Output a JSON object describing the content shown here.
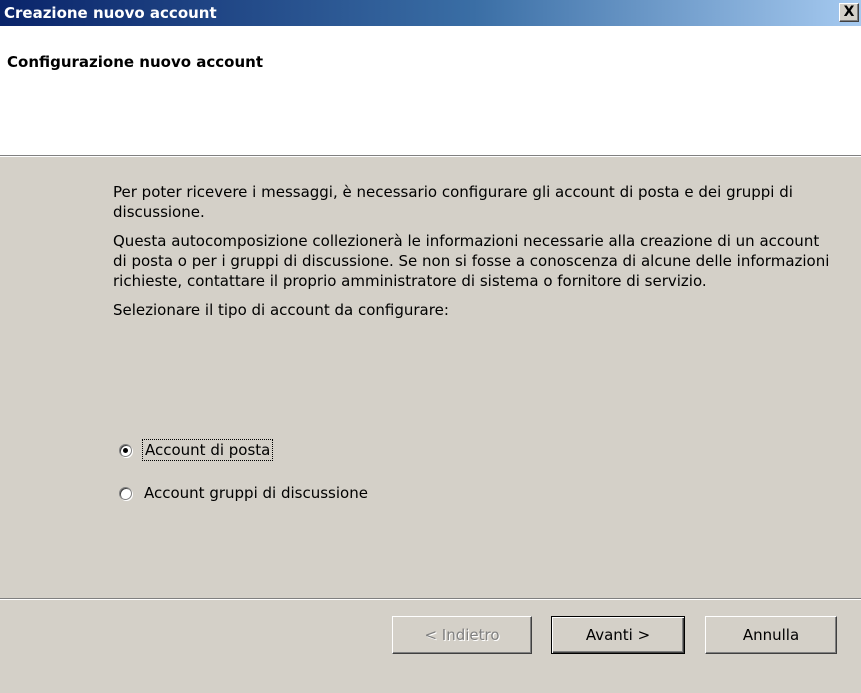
{
  "window": {
    "title": "Creazione nuovo account",
    "close_label": "X"
  },
  "header": {
    "title": "Configurazione nuovo account"
  },
  "body": {
    "paragraph1": "Per poter ricevere i messaggi, è necessario configurare gli account di posta e dei gruppi di discussione.",
    "paragraph2": "Questa autocomposizione collezionerà le informazioni necessarie alla creazione di un account di posta o per i gruppi di discussione. Se non si fosse a conoscenza di alcune delle informazioni richieste, contattare il proprio amministratore di sistema o fornitore di servizio.",
    "prompt": "Selezionare il tipo di account da configurare:"
  },
  "options": {
    "mail_label": "Account di posta",
    "mail_selected": true,
    "news_label": "Account gruppi di discussione",
    "news_selected": false
  },
  "buttons": {
    "back_label": "< Indietro",
    "back_enabled": false,
    "next_label": "Avanti >",
    "cancel_label": "Annulla"
  },
  "colors": {
    "titlebar_start": "#0a246a",
    "titlebar_end": "#a6caf0",
    "dialog_background": "#d4d0c8",
    "header_background": "#ffffff"
  }
}
